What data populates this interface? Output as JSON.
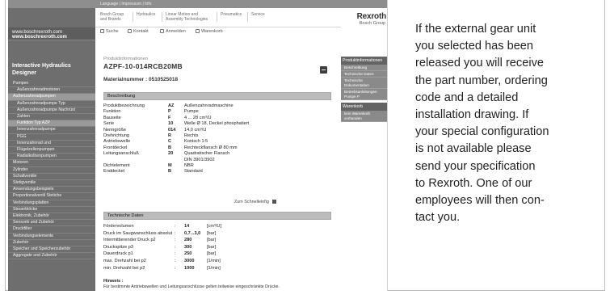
{
  "description": {
    "lines": [
      "If the external gear unit",
      "you selected has been",
      "released you will receive",
      "the part number, ordering",
      "code and a detailed",
      "installation drawing. If",
      "your special configuration",
      "is not available please",
      "send your specification",
      "to Rexroth. One of our",
      "employees will then con-",
      "tact you."
    ]
  },
  "browser": {
    "header": {
      "util_links": "Language | Impressum | Info",
      "nav": [
        "Bosch Group\nand Brands",
        "Hydraulics",
        "Linear Motion and\nAssembly Technologies",
        "Pneumatics",
        "Service"
      ],
      "logo": "Rexroth",
      "logo_sub": "Bosch Group"
    },
    "left": {
      "url1": "www.boschrexroth.com",
      "url2": "www.boschrexroth.com",
      "app_title": "Interactive Hydraulics Designer",
      "menu": [
        {
          "label": "Pumpen",
          "level": 0,
          "active": false
        },
        {
          "label": "Außenzahnradmotoren",
          "level": 1,
          "active": false
        },
        {
          "label": "Außenzahnradpumpen",
          "level": 0,
          "active": true
        },
        {
          "label": "Außenzahnradpumpe Typ",
          "level": 1,
          "active": false
        },
        {
          "label": "Außenzahnradpumpe Nachrüst",
          "level": 1,
          "active": false
        },
        {
          "label": "Zahlen",
          "level": 1,
          "active": false
        },
        {
          "label": "Funktion Typ AZP",
          "level": 1,
          "active": true
        },
        {
          "label": "Innenzahnradpumpe",
          "level": 1,
          "active": false
        },
        {
          "label": "PGG",
          "level": 1,
          "active": false
        },
        {
          "label": "Innenzahnrad und",
          "level": 1,
          "active": false
        },
        {
          "label": "Flügelzellenpumpen",
          "level": 1,
          "active": false
        },
        {
          "label": "Radialkolbenpumpen",
          "level": 1,
          "active": false
        },
        {
          "label": "Motoren",
          "level": 0,
          "active": false
        },
        {
          "label": "Zylinder",
          "level": 0,
          "active": false
        },
        {
          "label": "Schaltventile",
          "level": 0,
          "active": false
        },
        {
          "label": "Stetigventile",
          "level": 0,
          "active": false
        },
        {
          "label": "Anwendungsbeispiele",
          "level": 0,
          "active": false
        },
        {
          "label": "Proportionalventil Stetiche",
          "level": 0,
          "active": false
        },
        {
          "label": "Verbindungsplatten",
          "level": 0,
          "active": false
        },
        {
          "label": "Steuerblöcke",
          "level": 0,
          "active": false
        },
        {
          "label": "Elektronik, Zubehör",
          "level": 0,
          "active": false
        },
        {
          "label": "Sensorik und Zubehör",
          "level": 0,
          "active": false
        },
        {
          "label": "Druckfilter",
          "level": 0,
          "active": false
        },
        {
          "label": "Verbindungselemente",
          "level": 0,
          "active": false
        },
        {
          "label": "Zubehör",
          "level": 0,
          "active": false
        },
        {
          "label": "Speicher und Speicherzubehör",
          "level": 0,
          "active": false
        },
        {
          "label": "Aggregate und Zubehör",
          "level": 0,
          "active": false
        }
      ]
    },
    "toolbar": [
      {
        "label": "Suche",
        "icon": "search-icon"
      },
      {
        "label": "Kontakt",
        "icon": "contact-icon"
      },
      {
        "label": "Anmelden",
        "icon": "login-icon"
      },
      {
        "label": "Warenkorb",
        "icon": "cart-icon"
      }
    ],
    "product": {
      "label": "Produktinformationen",
      "name": "AZPF-10-014RCB20MB",
      "material_no": "Materialnummer : 0510525018"
    },
    "description_section": {
      "title": "Beschreibung",
      "rows": [
        {
          "key": "Produktbezeichnung",
          "code": "AZ",
          "value": "Außenzahnradmaschine"
        },
        {
          "key": "Funktion",
          "code": "P",
          "value": "Pumpe"
        },
        {
          "key": "Bauseite",
          "code": "F",
          "value": "4 ... 28 cm³/U"
        },
        {
          "key": "Serie",
          "code": "10",
          "value": "Welle Ø 18, Deckel phosphatiert"
        },
        {
          "key": "Nenngröße",
          "code": "014",
          "value": "14,0 cm³/U"
        },
        {
          "key": "Drehrichtung",
          "code": "R",
          "value": "Rechts"
        },
        {
          "key": "Antriebswelle",
          "code": "C",
          "value": "Konisch 1:5"
        },
        {
          "key": "Frontdeckel",
          "code": "B",
          "value": "Rechteckflansch Ø 80 mm"
        },
        {
          "key": "Leitungsanschluß",
          "code": "20",
          "value": "Quadratischer Flansch",
          "value2": "DIN 3901/3902"
        },
        {
          "key": "Dichtelement",
          "code": "M",
          "value": "NBR"
        },
        {
          "key": "Enddeckel",
          "code": "B",
          "value": "Standard"
        }
      ]
    },
    "zum_link": "Zum Schnelleinfig",
    "tech_section": {
      "title": "Technische Daten",
      "rows": [
        {
          "key": "Fördervolumen",
          "sep": ":",
          "value": "14",
          "unit": "[cm³/U]"
        },
        {
          "key": "Druck im Saugwanschluss absolut",
          "sep": ":",
          "value": "0,7...3,0",
          "unit": "[bar]"
        },
        {
          "key": "Intermittierender Druck p2",
          "sep": ":",
          "value": "280",
          "unit": "[bar]"
        },
        {
          "key": "Druckspitze p3",
          "sep": ":",
          "value": "300",
          "unit": "[bar]"
        },
        {
          "key": "Dauerdruck p1",
          "sep": ":",
          "value": "250",
          "unit": "[bar]"
        },
        {
          "key": "max. Drehzahl bei p2",
          "sep": ":",
          "value": "3000",
          "unit": "[1/min]"
        },
        {
          "key": "min. Drehzahl bei p2",
          "sep": ":",
          "value": "1000",
          "unit": "[1/min]"
        }
      ]
    },
    "hinweis": {
      "title": "Hinweis :",
      "text": "Für bestimmte Antriebswellen und Leitungsanschlüsse gelten teilweise eingeschränkte Drücke."
    },
    "right_panel": {
      "head1": "Produktinformationen",
      "items1": [
        "Beschreibung",
        "Technische Daten",
        "Technische\nDokumentation",
        "Betriebsanleitungen\nPumpe P"
      ],
      "head2": "Warenkorb",
      "items2": [
        "kein Warenkorb\nvorhanden"
      ]
    }
  }
}
